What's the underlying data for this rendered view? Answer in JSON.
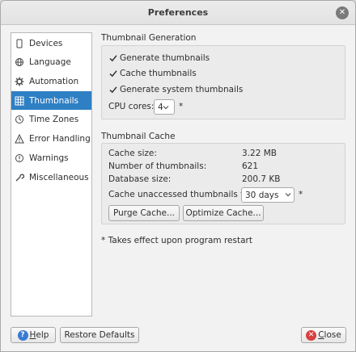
{
  "window": {
    "title": "Preferences",
    "close_glyph": "✕"
  },
  "sidebar": {
    "items": [
      {
        "label": "Devices",
        "icon": "device-icon"
      },
      {
        "label": "Language",
        "icon": "globe-icon"
      },
      {
        "label": "Automation",
        "icon": "gear-icon"
      },
      {
        "label": "Thumbnails",
        "icon": "grid-icon",
        "active": true
      },
      {
        "label": "Time Zones",
        "icon": "clock-icon"
      },
      {
        "label": "Error Handling",
        "icon": "warning-icon"
      },
      {
        "label": "Warnings",
        "icon": "info-icon"
      },
      {
        "label": "Miscellaneous",
        "icon": "wrench-icon"
      }
    ]
  },
  "thumbnail_generation": {
    "title": "Thumbnail Generation",
    "generate_thumbnails": {
      "label": "Generate thumbnails",
      "checked": true
    },
    "cache_thumbnails": {
      "label": "Cache thumbnails",
      "checked": true
    },
    "generate_system_thumbnails": {
      "label": "Generate system thumbnails",
      "checked": true
    },
    "cpu_cores": {
      "label": "CPU cores:",
      "value": "4",
      "marker": "*"
    }
  },
  "thumbnail_cache": {
    "title": "Thumbnail Cache",
    "cache_size": {
      "label": "Cache size:",
      "value": "3.22 MB"
    },
    "num_thumbnails": {
      "label": "Number of thumbnails:",
      "value": "621"
    },
    "db_size": {
      "label": "Database size:",
      "value": "200.7 KB"
    },
    "unaccessed": {
      "label": "Cache unaccessed thumbnails for:",
      "value": "30 days",
      "marker": "*"
    },
    "purge_label": "Purge Cache...",
    "optimize_label": "Optimize Cache..."
  },
  "note": "* Takes effect upon program restart",
  "footer": {
    "help_mnemonic": "H",
    "help_rest": "elp",
    "restore_label": "Restore Defaults",
    "close_mnemonic": "C",
    "close_rest": "lose"
  }
}
